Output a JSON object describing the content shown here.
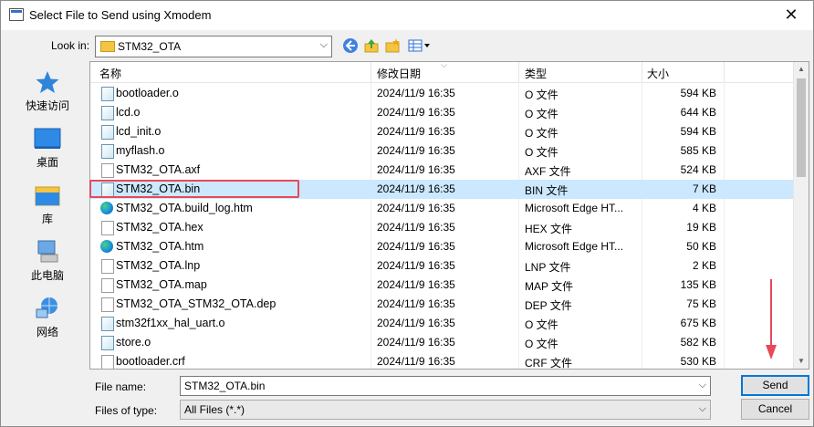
{
  "window": {
    "title": "Select File to Send using Xmodem",
    "close": "✕"
  },
  "toolbar": {
    "look_in_label": "Look in:",
    "look_in_value": "STM32_OTA"
  },
  "places": [
    {
      "label": "快速访问",
      "icon": "star-icon"
    },
    {
      "label": "桌面",
      "icon": "desktop-icon"
    },
    {
      "label": "库",
      "icon": "library-icon"
    },
    {
      "label": "此电脑",
      "icon": "computer-icon"
    },
    {
      "label": "网络",
      "icon": "network-icon"
    }
  ],
  "columns": {
    "name": "名称",
    "date": "修改日期",
    "type": "类型",
    "size": "大小"
  },
  "files": [
    {
      "name": "bootloader.o",
      "date": "2024/11/9 16:35",
      "type": "O 文件",
      "size": "594 KB",
      "icon": "obj"
    },
    {
      "name": "lcd.o",
      "date": "2024/11/9 16:35",
      "type": "O 文件",
      "size": "644 KB",
      "icon": "obj"
    },
    {
      "name": "lcd_init.o",
      "date": "2024/11/9 16:35",
      "type": "O 文件",
      "size": "594 KB",
      "icon": "obj"
    },
    {
      "name": "myflash.o",
      "date": "2024/11/9 16:35",
      "type": "O 文件",
      "size": "585 KB",
      "icon": "obj"
    },
    {
      "name": "STM32_OTA.axf",
      "date": "2024/11/9 16:35",
      "type": "AXF 文件",
      "size": "524 KB",
      "icon": "generic"
    },
    {
      "name": "STM32_OTA.bin",
      "date": "2024/11/9 16:35",
      "type": "BIN 文件",
      "size": "7 KB",
      "icon": "obj",
      "selected": true
    },
    {
      "name": "STM32_OTA.build_log.htm",
      "date": "2024/11/9 16:35",
      "type": "Microsoft Edge HT...",
      "size": "4 KB",
      "icon": "edge"
    },
    {
      "name": "STM32_OTA.hex",
      "date": "2024/11/9 16:35",
      "type": "HEX 文件",
      "size": "19 KB",
      "icon": "generic"
    },
    {
      "name": "STM32_OTA.htm",
      "date": "2024/11/9 16:35",
      "type": "Microsoft Edge HT...",
      "size": "50 KB",
      "icon": "edge"
    },
    {
      "name": "STM32_OTA.lnp",
      "date": "2024/11/9 16:35",
      "type": "LNP 文件",
      "size": "2 KB",
      "icon": "generic"
    },
    {
      "name": "STM32_OTA.map",
      "date": "2024/11/9 16:35",
      "type": "MAP 文件",
      "size": "135 KB",
      "icon": "generic"
    },
    {
      "name": "STM32_OTA_STM32_OTA.dep",
      "date": "2024/11/9 16:35",
      "type": "DEP 文件",
      "size": "75 KB",
      "icon": "generic"
    },
    {
      "name": "stm32f1xx_hal_uart.o",
      "date": "2024/11/9 16:35",
      "type": "O 文件",
      "size": "675 KB",
      "icon": "obj"
    },
    {
      "name": "store.o",
      "date": "2024/11/9 16:35",
      "type": "O 文件",
      "size": "582 KB",
      "icon": "obj"
    },
    {
      "name": "bootloader.crf",
      "date": "2024/11/9 16:35",
      "type": "CRF 文件",
      "size": "530 KB",
      "icon": "generic"
    }
  ],
  "form": {
    "file_name_label": "File name:",
    "file_name_value": "STM32_OTA.bin",
    "files_of_type_label": "Files of type:",
    "files_of_type_value": "All Files (*.*)"
  },
  "buttons": {
    "send": "Send",
    "cancel": "Cancel"
  },
  "colors": {
    "selection": "#cce8ff",
    "highlight_border": "#e8485a",
    "accent": "#0078d7"
  }
}
